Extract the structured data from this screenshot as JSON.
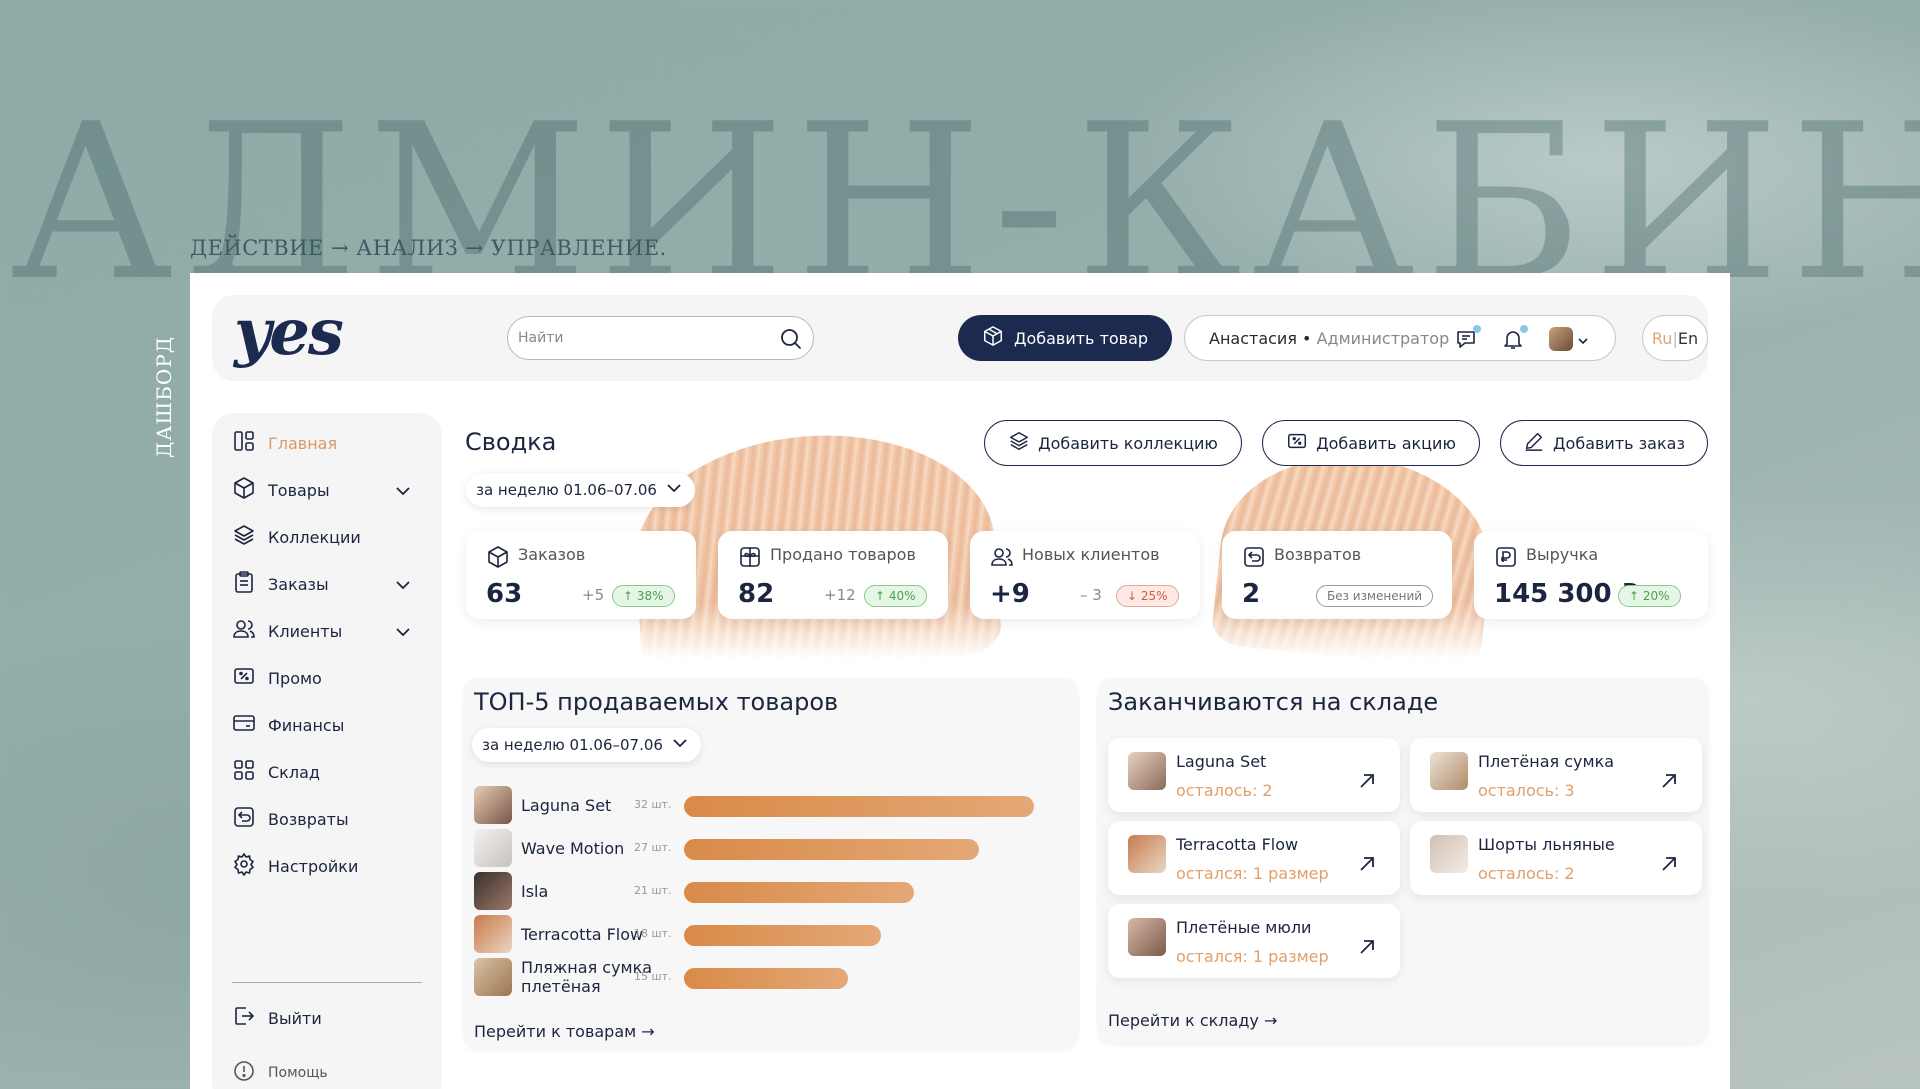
{
  "background": {
    "title": "АДМИН-КАБИНЕТ",
    "tagline": "ДЕЙСТВИЕ → АНАЛИЗ → УПРАВЛЕНИЕ.",
    "vertical_label": "ДАШБОРД"
  },
  "header": {
    "logo": "yes",
    "search_placeholder": "Найти",
    "add_product_label": "Добавить товар",
    "user_name": "Анастасия",
    "user_sep": " • ",
    "user_role": "Администратор",
    "lang_ru": "Ru",
    "lang_sep": "|",
    "lang_en": "En"
  },
  "sidebar": {
    "items": [
      {
        "label": "Главная",
        "icon": "home-icon",
        "active": true
      },
      {
        "label": "Товары",
        "icon": "box-icon",
        "expandable": true
      },
      {
        "label": "Коллекции",
        "icon": "layers-icon"
      },
      {
        "label": "Заказы",
        "icon": "clipboard-icon",
        "expandable": true
      },
      {
        "label": "Клиенты",
        "icon": "users-icon",
        "expandable": true
      },
      {
        "label": "Промо",
        "icon": "promo-icon"
      },
      {
        "label": "Финансы",
        "icon": "card-icon"
      },
      {
        "label": "Склад",
        "icon": "grid-icon"
      },
      {
        "label": "Возвраты",
        "icon": "return-icon"
      },
      {
        "label": "Настройки",
        "icon": "gear-icon"
      }
    ],
    "logout": "Выйти",
    "help": "Помощь"
  },
  "summary": {
    "title": "Сводка",
    "period": "за неделю 01.06–07.06",
    "actions": {
      "add_collection": "Добавить коллекцию",
      "add_promo": "Добавить акцию",
      "add_order": "Добавить заказ"
    },
    "stats": [
      {
        "label": "Заказов",
        "value": "63",
        "delta": "+5",
        "badge": "↑ 38%",
        "trend": "up"
      },
      {
        "label": "Продано товаров",
        "value": "82",
        "delta": "+12",
        "badge": "↑ 40%",
        "trend": "up"
      },
      {
        "label": "Новых клиентов",
        "value": "+9",
        "delta": "– 3",
        "badge": "↓ 25%",
        "trend": "down"
      },
      {
        "label": "Возвратов",
        "value": "2",
        "delta": "",
        "badge": "Без изменений",
        "trend": "none"
      },
      {
        "label": "Выручка",
        "value": "145 300 ₽",
        "delta": "",
        "badge": "↑ 20%",
        "trend": "up"
      }
    ]
  },
  "top5": {
    "title": "ТОП-5 продаваемых товаров",
    "period": "за неделю 01.06–07.06",
    "items": [
      {
        "name": "Laguna Set",
        "qty": "32 шт.",
        "value": 32
      },
      {
        "name": "Wave Motion",
        "qty": "27 шт.",
        "value": 27
      },
      {
        "name": "Isla",
        "qty": "21 шт.",
        "value": 21
      },
      {
        "name": "Terracotta Flow",
        "qty": "18 шт.",
        "value": 18
      },
      {
        "name": "Пляжная сумка плетёная",
        "qty": "15 шт.",
        "value": 15
      }
    ],
    "link": "Перейти к товарам →"
  },
  "stock": {
    "title": "Заканчиваются на складе",
    "items": [
      {
        "name": "Laguna Set",
        "left": "осталось: 2"
      },
      {
        "name": "Плетёная сумка",
        "left": "осталось: 3"
      },
      {
        "name": "Terracotta Flow",
        "left": "остался: 1 размер"
      },
      {
        "name": "Шорты льняные",
        "left": "осталось: 2"
      },
      {
        "name": "Плетёные мюли",
        "left": "остался: 1 размер"
      }
    ],
    "link": "Перейти к складу →"
  },
  "colors": {
    "navy": "#1c2a4f",
    "accent_orange": "#d99a67",
    "bar_orange": "#d98a48"
  }
}
